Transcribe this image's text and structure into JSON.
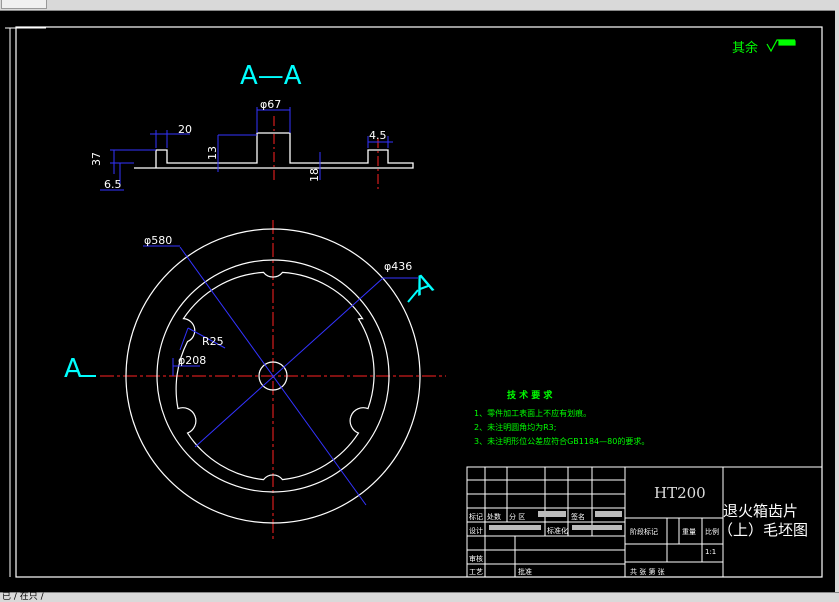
{
  "section_title": "A—A",
  "surface_note": "其余",
  "dimensions": {
    "d67": "φ67",
    "w20": "20",
    "h13": "13",
    "h37": "37",
    "h6_5": "6.5",
    "w4_5": "4.5",
    "h18": "18",
    "d580": "φ580",
    "d436": "φ436",
    "r25": "R25",
    "d208": "φ208"
  },
  "section_markers": {
    "left": "A",
    "right": "A"
  },
  "tech_requirements": {
    "title": "技 术 要 求",
    "items": [
      "1、零件加工表面上不应有划痕。",
      "2、未注明圆角均为R3;",
      "3、未注明形位公差应符合GB1184—80的要求。"
    ]
  },
  "title_block": {
    "material": "HT200",
    "part_name_line1": "退火箱齿片",
    "part_name_line2": "（上）毛坯图",
    "labels": {
      "mark": "标记",
      "count": "处数",
      "zone": "分 区",
      "signature": "签名",
      "design": "设计",
      "standardize": "标准化",
      "stage_mark": "阶段标记",
      "weight": "重量",
      "scale": "比例",
      "review": "审核",
      "process": "工艺",
      "approve": "批准",
      "sheets": "共   张   第   张"
    },
    "scale_value": "1:1"
  },
  "status_text": "已 / 在只 /"
}
